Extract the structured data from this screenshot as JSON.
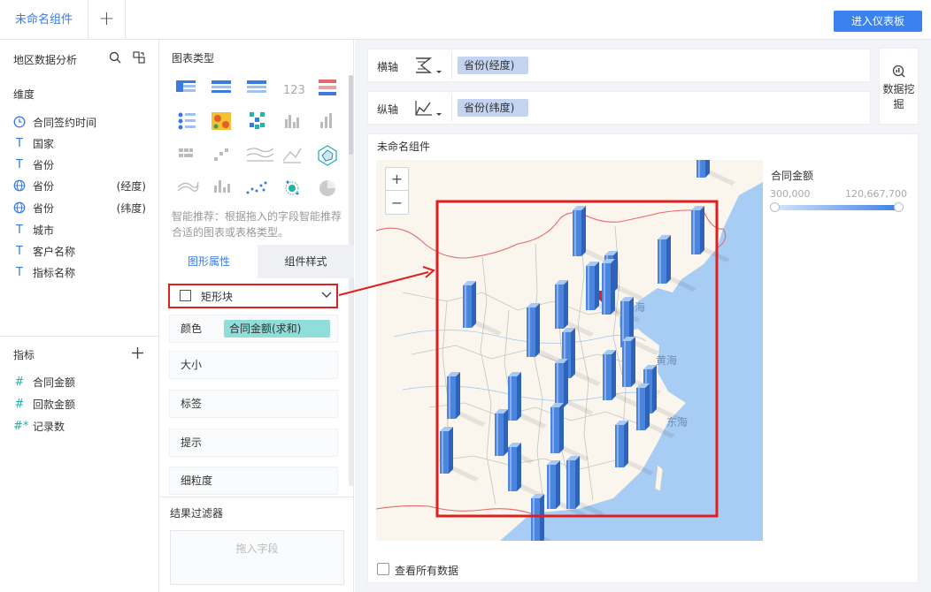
{
  "topbar": {
    "active_tab": "未命名组件",
    "add_tab": "+",
    "enter_button": "进入仪表板"
  },
  "left_panel": {
    "dataset_title": "地区数据分析",
    "dimensions_label": "维度",
    "dimensions": [
      {
        "icon": "clock-icon",
        "label": "合同签约时间",
        "suffix": ""
      },
      {
        "icon": "text-type-icon",
        "label": "国家",
        "suffix": ""
      },
      {
        "icon": "text-type-icon",
        "label": "省份",
        "suffix": ""
      },
      {
        "icon": "globe-icon",
        "label": "省份",
        "suffix": "(经度)"
      },
      {
        "icon": "globe-icon",
        "label": "省份",
        "suffix": "(纬度)"
      },
      {
        "icon": "text-type-icon",
        "label": "城市",
        "suffix": ""
      },
      {
        "icon": "text-type-icon",
        "label": "客户名称",
        "suffix": ""
      },
      {
        "icon": "text-type-icon",
        "label": "指标名称",
        "suffix": ""
      }
    ],
    "metrics_label": "指标",
    "metrics": [
      {
        "icon": "hash-icon",
        "label": "合同金额"
      },
      {
        "icon": "hash-icon",
        "label": "回款金额"
      },
      {
        "icon": "hash-star-icon",
        "label": "记录数"
      }
    ]
  },
  "middle_panel": {
    "chart_type_title": "图表类型",
    "hint": "智能推荐：根据拖入的字段智能推荐合适的图表或表格类型。",
    "tabs": [
      "图形属性",
      "组件样式"
    ],
    "shape_select": "矩形块",
    "properties": {
      "color": "颜色",
      "color_field": "合同金额(求和)",
      "size": "大小",
      "label": "标签",
      "tooltip": "提示",
      "granularity": "细粒度"
    },
    "filter_title": "结果过滤器",
    "filter_placeholder": "拖入字段"
  },
  "axes": {
    "x_label": "横轴",
    "x_field": "省份(经度)",
    "y_label": "纵轴",
    "y_field": "省份(纬度)"
  },
  "mining": {
    "label": "数据挖掘"
  },
  "chart": {
    "title": "未命名组件",
    "legend_title": "合同金额",
    "legend_min": "300,000",
    "legend_max": "120,667,700",
    "sea_labels": [
      "渤海",
      "黄海",
      "东海"
    ],
    "zoom_in": "+",
    "zoom_out": "−"
  },
  "footer": {
    "check_all": "查看所有数据"
  },
  "colors": {
    "accent": "#3b82ee",
    "bar": "#4a86e0",
    "highlight": "#e02020",
    "teal_chip": "#8fded9"
  }
}
